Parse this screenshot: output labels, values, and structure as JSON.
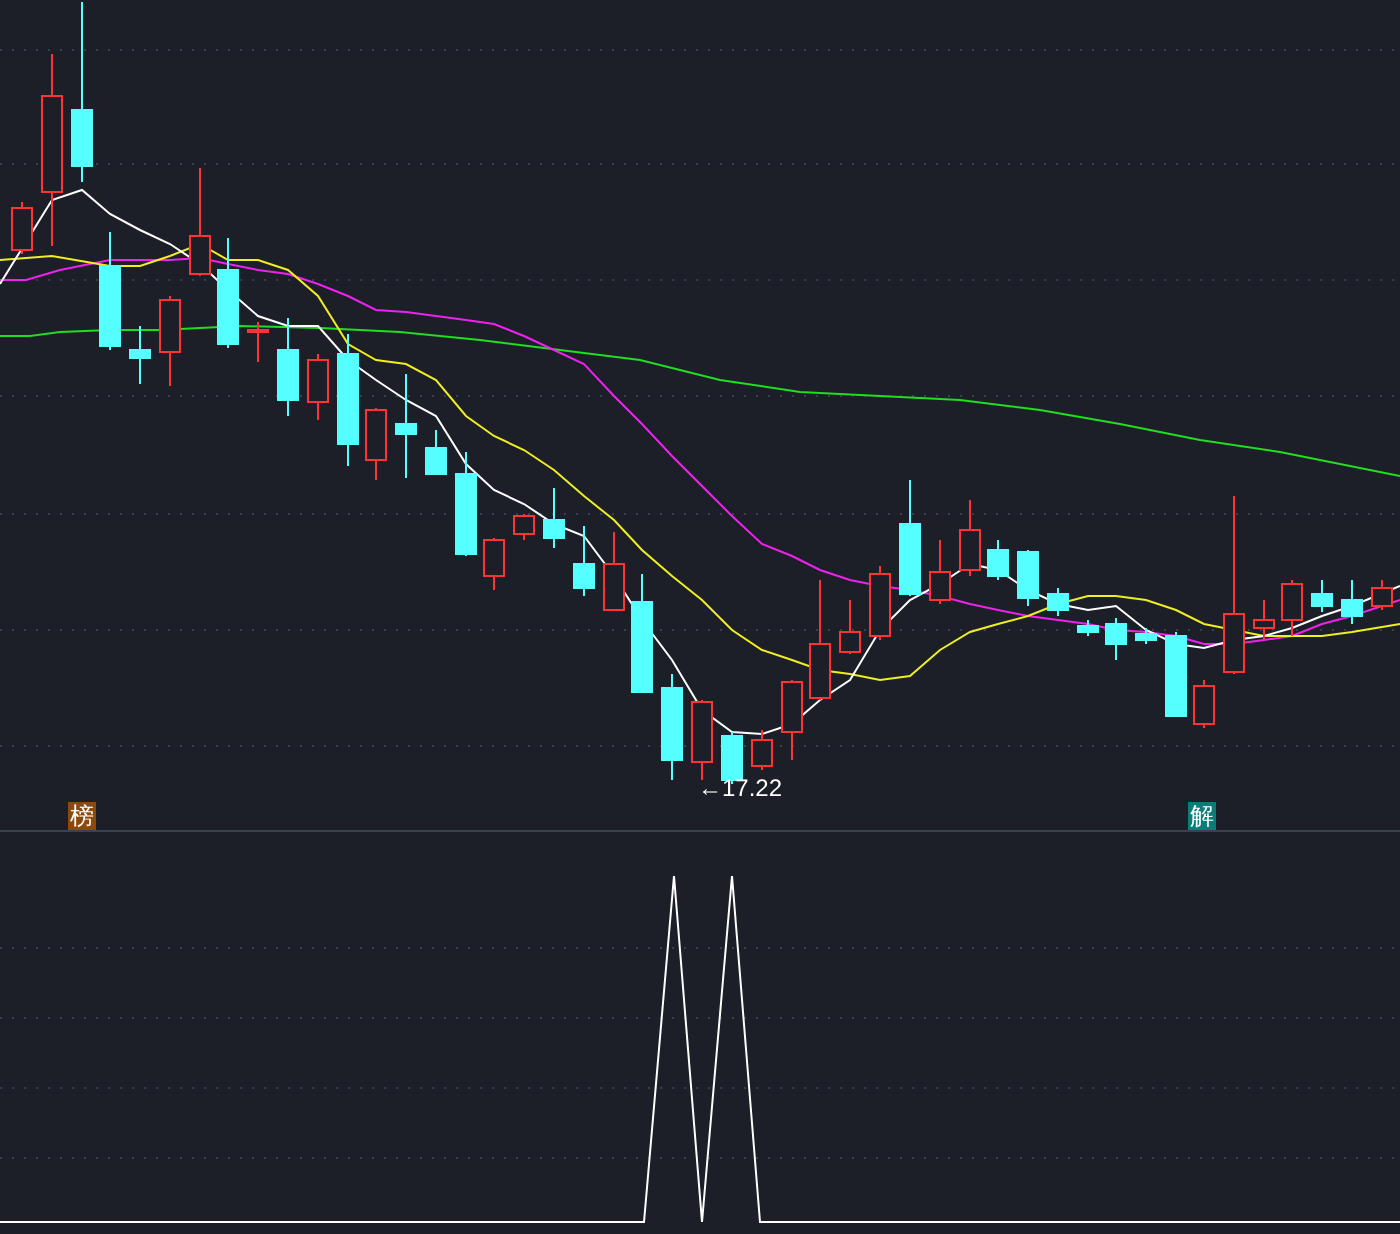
{
  "price_panel": {
    "low_marker": "←17.22",
    "signals": [
      {
        "text": "榜",
        "color": "#8a4a0e"
      },
      {
        "text": "解",
        "color": "#0a7d78"
      }
    ]
  }
}
